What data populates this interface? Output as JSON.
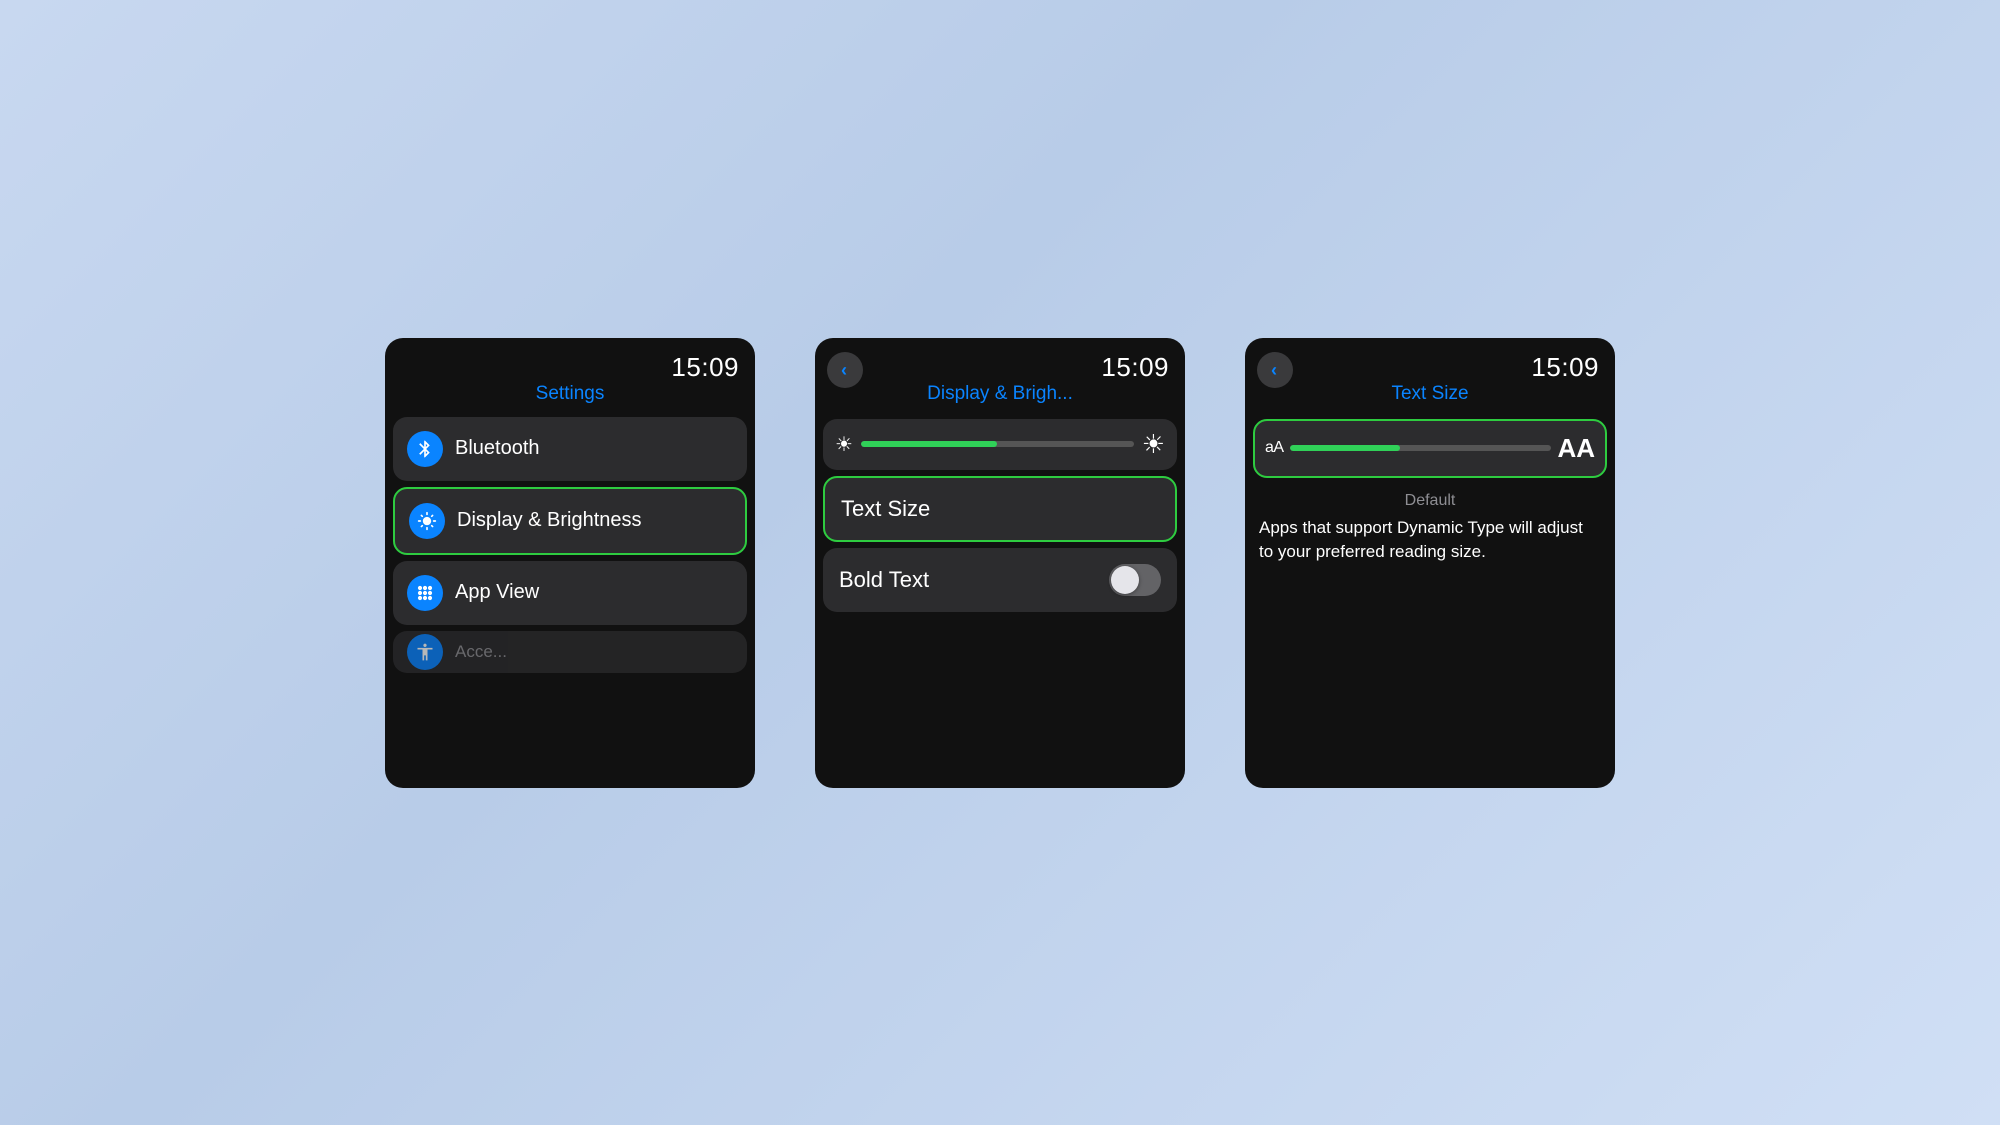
{
  "background": {
    "color": "#c8d8f0"
  },
  "screen1": {
    "time": "15:09",
    "title": "Settings",
    "items": [
      {
        "id": "bluetooth",
        "label": "Bluetooth",
        "icon": "bluetooth",
        "highlighted": false
      },
      {
        "id": "display-brightness",
        "label": "Display & Brightness",
        "icon": "display",
        "highlighted": true
      },
      {
        "id": "app-view",
        "label": "App View",
        "icon": "appview",
        "highlighted": false
      }
    ],
    "partial_item_label": "Accessibility"
  },
  "screen2": {
    "time": "15:09",
    "title": "Display & Brigh...",
    "back_label": "<",
    "brightness_slider_pct": 50,
    "items": [
      {
        "id": "text-size",
        "label": "Text Size",
        "highlighted": true
      }
    ],
    "bold_text_label": "Bold Text",
    "bold_text_enabled": false
  },
  "screen3": {
    "time": "15:09",
    "title": "Text Size",
    "back_label": "<",
    "slider_pct": 42,
    "text_small_label": "aA",
    "text_large_label": "AA",
    "default_label": "Default",
    "description": "Apps that support Dynamic Type will adjust to your preferred reading size."
  }
}
